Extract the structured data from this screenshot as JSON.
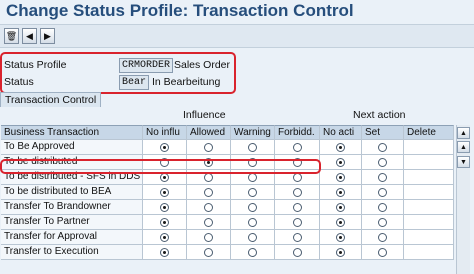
{
  "title": "Change Status Profile: Transaction Control",
  "toolbar": {
    "buttons": [
      {
        "icon": "delete-icon",
        "glyph": "🗑"
      },
      {
        "icon": "previous-icon",
        "glyph": "◀"
      },
      {
        "icon": "next-icon",
        "glyph": "▶"
      }
    ]
  },
  "header": {
    "status_profile_label": "Status Profile",
    "status_profile_value": "CRMORDER",
    "status_profile_desc": "Sales Order",
    "status_label": "Status",
    "status_value": "Bear",
    "status_desc": "In Bearbeitung"
  },
  "tab": "Transaction Control",
  "groups": {
    "influence": "Influence",
    "next_action": "Next action"
  },
  "table": {
    "columns": [
      "Business Transaction",
      "No influ",
      "Allowed",
      "Warning",
      "Forbidd.",
      "No acti",
      "Set",
      "Delete"
    ],
    "rows": [
      {
        "name": "To Be Approved",
        "influence": 0,
        "next": 0
      },
      {
        "name": "To be distributed",
        "influence": 1,
        "next": 0
      },
      {
        "name": "To be distributed - SFS in DDS",
        "influence": 0,
        "next": 0
      },
      {
        "name": "To be distributed to BEA",
        "influence": 0,
        "next": 0
      },
      {
        "name": "Transfer To Brandowner",
        "influence": 0,
        "next": 0
      },
      {
        "name": "Transfer To Partner",
        "influence": 0,
        "next": 0
      },
      {
        "name": "Transfer for Approval",
        "influence": 0,
        "next": 0
      },
      {
        "name": "Transfer to Execution",
        "influence": 0,
        "next": 0
      }
    ]
  },
  "colors": {
    "title": "#264e7c",
    "highlight": "#d9232d",
    "header_bg": "#c7d7e7"
  }
}
